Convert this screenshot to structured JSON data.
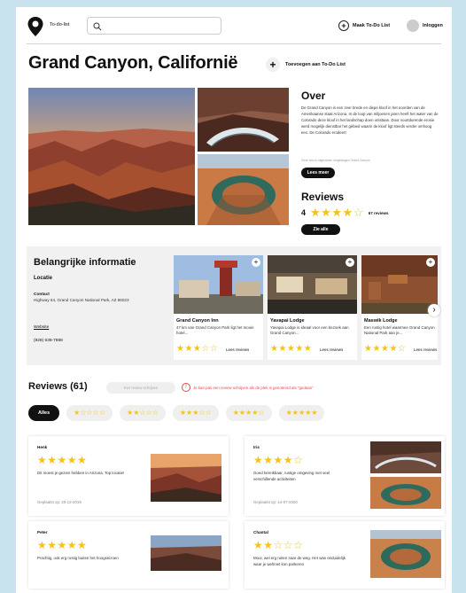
{
  "header": {
    "logo_text": "To-do-list",
    "search_placeholder": "",
    "make_list_label": "Maak To-Do List",
    "login_label": "Inloggen"
  },
  "title": "Grand Canyon, Californië",
  "add_to_list_label": "Toevoegen aan To-Do List",
  "about": {
    "heading": "Over",
    "text": "De Grand Canyon is een zeer brede en diepe kloof in het noorden van de Amerikaanse staat Arizona. In de loop van miljoenen jaren heeft het water van de Colorado deze kloof in het landschap doen ontstaan. Door voortdurende erosie werd mogelijk dienstbar het gebied waarin de kloof ligt steeds verder omhoog ees. De Colorado erodeert",
    "caption": "Deze foto is uitgesloten omgeslagen Grand Canyon",
    "read_more": "Lees meer"
  },
  "reviews_summary": {
    "heading": "Reviews",
    "score": "4",
    "stars_filled": 4,
    "count_label": "67 reviews",
    "see_all": "Zie alle"
  },
  "info": {
    "heading": "Belangrijke informatie",
    "location_label": "Locatie",
    "contact_label": "Contact",
    "address": "Highway 64, Grand Canyon National Park, AZ 86023",
    "website": "Website",
    "phone": "(928) 638-7888"
  },
  "hotels": [
    {
      "name": "Grand Canyon Inn",
      "desc": "47 km van Grand Canyon Park ligt het mooie hotel...",
      "stars": "★★★☆☆",
      "reviews_label": "Lees reviews"
    },
    {
      "name": "Yavapai Lodge",
      "desc": "Yavapai Lodge is ideaal voor een bezoek aan Grand Canyon...",
      "stars": "★★★★★",
      "reviews_label": "Lees reviews"
    },
    {
      "name": "Maswik Lodge",
      "desc": "Een rustig hotel waarmee Grand Canyon National Park aan je...",
      "stars": "★★★★☆",
      "reviews_label": "Lees reviews"
    }
  ],
  "reviews_section": {
    "heading": "Reviews (61)",
    "write_review": "Een review schrijven",
    "warning": "Je kan pas een review schrijven als de plek is genoteerd als \"gedaan\""
  },
  "filters": [
    "Alles",
    "★☆☆☆☆",
    "★★☆☆☆",
    "★★★☆☆",
    "★★★★☆",
    "★★★★★"
  ],
  "reviews": [
    {
      "name": "Henk",
      "stars": "★★★★★",
      "text": "Dit moest je gezien hebben in Arizona. Top locatie!",
      "date": "Geplaatst op: 20-12-2019"
    },
    {
      "name": "Iris",
      "stars": "★★★★☆",
      "text": "Goed bereikbaar, rustige omgeving met veel verschillende activiteiten",
      "date": "Geplaatst op: 14-07-2020"
    },
    {
      "name": "Peter",
      "stars": "★★★★★",
      "text": "Prachtig, ook erg rustig buiten het hoogseizoen",
      "date": ""
    },
    {
      "name": "Chantal",
      "stars": "★★☆☆☆",
      "text": "Mooi, wel erg ruiten naar de weg. Het was onduidelijk waar je wel/niet kon parkeren",
      "date": ""
    }
  ],
  "colors": {
    "star": "#f2c318",
    "accent_black": "#111111",
    "warning": "#d94c4c"
  }
}
